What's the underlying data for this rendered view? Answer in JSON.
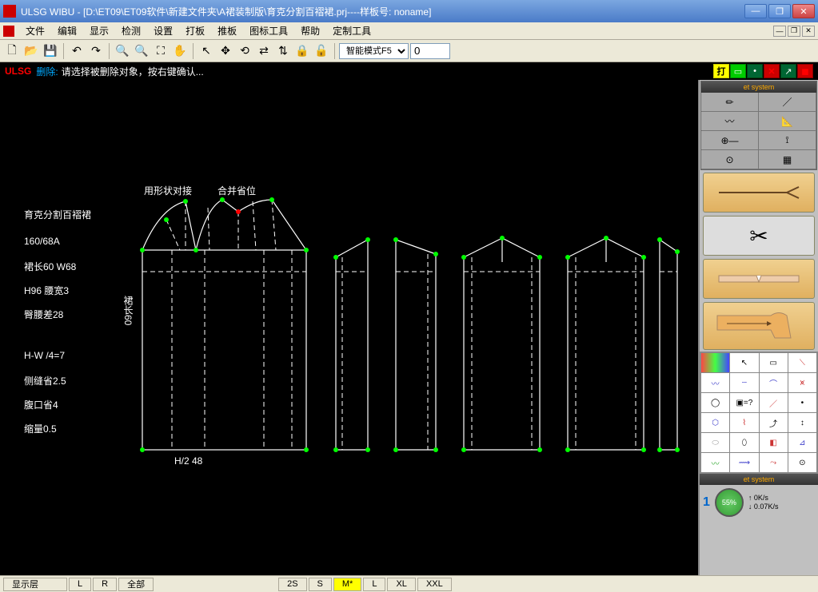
{
  "window": {
    "title": "ULSG WIBU - [D:\\ET09\\ET09软件\\新建文件夹\\A裙装制版\\育克分割百褶裙.prj----样板号: noname]"
  },
  "menu": {
    "items": [
      "文件",
      "编辑",
      "显示",
      "检测",
      "设置",
      "打板",
      "推板",
      "图标工具",
      "帮助",
      "定制工具"
    ]
  },
  "toolbar": {
    "mode_label": "智能模式F5",
    "num_value": "0"
  },
  "status": {
    "red": "ULSG",
    "blue": "删除:",
    "msg": "请选择被删除对象，按右键确认..."
  },
  "canvas": {
    "top_labels": [
      "用形状对接",
      "合并省位"
    ],
    "left_labels": [
      "育克分割百褶裙",
      "160/68A",
      "裙长60  W68",
      "H96   腰宽3",
      "臀腰差28",
      "H-W  /4=7",
      "侧缝省2.5",
      "腹口省4",
      "缩量0.5"
    ],
    "v_label": "裙长60",
    "bottom_label": "H/2    48"
  },
  "right": {
    "header": "et system",
    "gauge": "55%",
    "net_up": "0K/s",
    "net_down": "0.07K/s"
  },
  "bottom": {
    "show_layer": "显示层",
    "L": "L",
    "R": "R",
    "all": "全部",
    "sizes": [
      "2S",
      "S",
      "M*",
      "L",
      "XL",
      "XXL"
    ]
  }
}
